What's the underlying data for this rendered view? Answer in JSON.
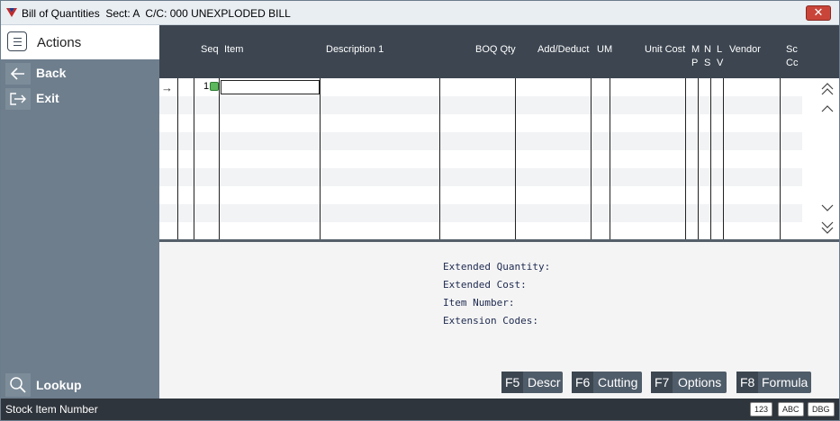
{
  "window": {
    "title": "Bill of Quantities  Sect: A  C/C: 000 UNEXPLODED BILL",
    "close_glyph": "✕"
  },
  "sidebar": {
    "actions_label": "Actions",
    "items": [
      {
        "label": "Back",
        "icon": "arrow-left-icon"
      },
      {
        "label": "Exit",
        "icon": "exit-icon"
      }
    ],
    "lookup_label": "Lookup"
  },
  "grid": {
    "headers": {
      "seq": "Seq",
      "item": "Item",
      "description": "Description 1",
      "boq_qty": "BOQ Qty",
      "add_deduct": "Add/Deduct",
      "um": "UM",
      "unit_cost": "Unit Cost",
      "mp_top": "M",
      "mp_bottom": "P",
      "ns_top": "N",
      "ns_bottom": "S",
      "lv_top": "L",
      "lv_bottom": "V",
      "vendor": "Vendor",
      "sc_top": "Sc",
      "sc_bottom": "Cc"
    },
    "rows": [
      {
        "seq": "1",
        "item": ""
      }
    ],
    "row_arrow": "→"
  },
  "detail": {
    "extended_quantity": "Extended Quantity:",
    "extended_cost": "Extended Cost:",
    "item_number": "Item Number:",
    "extension_codes": "Extension Codes:"
  },
  "function_keys": [
    {
      "key": "F5",
      "label": "Descr"
    },
    {
      "key": "F6",
      "label": "Cutting"
    },
    {
      "key": "F7",
      "label": "Options"
    },
    {
      "key": "F8",
      "label": "Formula"
    }
  ],
  "statusbar": {
    "text": "Stock Item Number",
    "badges": [
      "123",
      "ABC",
      "DBG"
    ]
  },
  "colors": {
    "sidebar": "#6e7e8d",
    "header": "#3c4550",
    "statusbar": "#2f353c",
    "close": "#c9453a"
  }
}
